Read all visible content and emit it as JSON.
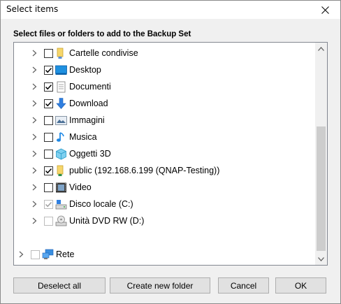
{
  "window": {
    "title": "Select items"
  },
  "instruction": "Select files or folders to add to the Backup Set",
  "tree": {
    "items": [
      {
        "label": "Cartelle condivise",
        "checked": false,
        "icon": "shared-folder-icon",
        "disabled": false
      },
      {
        "label": "Desktop",
        "checked": true,
        "icon": "desktop-icon",
        "disabled": false
      },
      {
        "label": "Documenti",
        "checked": true,
        "icon": "documents-icon",
        "disabled": false
      },
      {
        "label": "Download",
        "checked": true,
        "icon": "download-icon",
        "disabled": false
      },
      {
        "label": "Immagini",
        "checked": false,
        "icon": "pictures-icon",
        "disabled": false
      },
      {
        "label": "Musica",
        "checked": false,
        "icon": "music-icon",
        "disabled": false
      },
      {
        "label": "Oggetti 3D",
        "checked": false,
        "icon": "objects-3d-icon",
        "disabled": false
      },
      {
        "label": "public (192.168.6.199 (QNAP-Testing))",
        "checked": true,
        "icon": "network-folder-icon",
        "disabled": false
      },
      {
        "label": "Video",
        "checked": false,
        "icon": "video-icon",
        "disabled": false
      },
      {
        "label": "Disco locale (C:)",
        "checked": true,
        "icon": "local-disk-icon",
        "disabled": true
      },
      {
        "label": "Unità DVD RW (D:)",
        "checked": false,
        "icon": "dvd-drive-icon",
        "disabled": true
      }
    ],
    "network": {
      "label": "Rete",
      "checked": false,
      "icon": "network-icon",
      "disabled": true
    }
  },
  "buttons": {
    "deselect_all": "Deselect all",
    "create_folder": "Create new folder",
    "cancel": "Cancel",
    "ok": "OK"
  }
}
